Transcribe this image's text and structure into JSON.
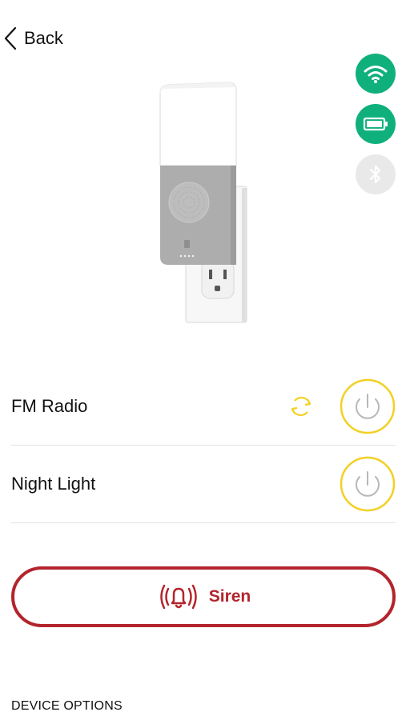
{
  "nav": {
    "back_label": "Back"
  },
  "status_icons": [
    {
      "name": "wifi-icon",
      "color": "#10b07c",
      "state": "connected"
    },
    {
      "name": "battery-icon",
      "color": "#10b07c",
      "state": "full"
    },
    {
      "name": "bluetooth-icon",
      "color": "#e9e9e9",
      "state": "disconnected"
    }
  ],
  "controls": [
    {
      "label": "FM Radio",
      "has_refresh": true,
      "power_color": "#f3d023"
    },
    {
      "label": "Night Light",
      "has_refresh": false,
      "power_color": "#f3d023"
    }
  ],
  "siren": {
    "label": "Siren",
    "color": "#b3242c"
  },
  "sections": {
    "device_options": "DEVICE OPTIONS"
  }
}
